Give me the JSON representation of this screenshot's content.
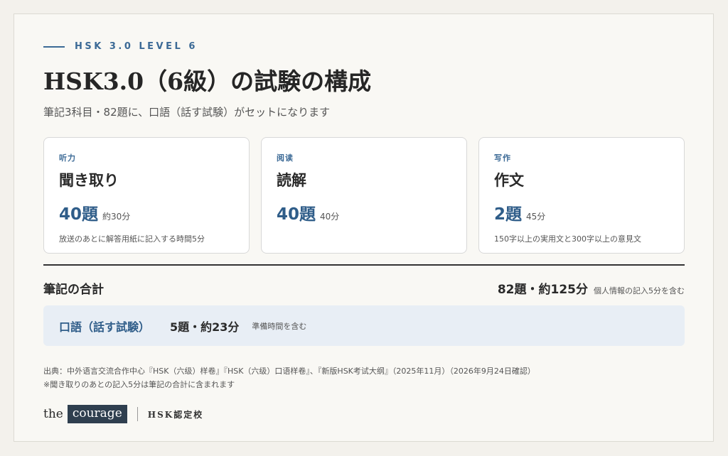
{
  "eyebrow": "HSK 3.0 LEVEL 6",
  "title": "HSK3.0（6級）の試験の構成",
  "subtitle": "筆記3科目・82題に、口語（話す試験）がセットになります",
  "cards": [
    {
      "category": "听力",
      "name": "聞き取り",
      "count": "40題",
      "time": "約30分",
      "note": "放送のあとに解答用紙に記入する時間5分"
    },
    {
      "category": "阅读",
      "name": "読解",
      "count": "40題",
      "time": "40分",
      "note": ""
    },
    {
      "category": "写作",
      "name": "作文",
      "count": "2題",
      "time": "45分",
      "note": "150字以上の実用文と300字以上の意見文"
    }
  ],
  "written_total": {
    "label": "筆記の合計",
    "value": "82題・約125分",
    "note": "個人情報の記入5分を含む"
  },
  "speaking": {
    "name": "口語（話す試験）",
    "value": "5題・約23分",
    "note": "準備時間を含む"
  },
  "source": {
    "line1": "出典：中外语言交流合作中心『HSK（六级）样卷』『HSK（六级）口语样卷』、『新版HSK考试大纲』（2025年11月）（2026年9月24日確認）",
    "line2": "※聞き取りのあとの記入5分は筆記の合計に含まれます"
  },
  "footer": {
    "logo_the": "the",
    "logo_courage": "courage",
    "school": "HSK認定校"
  }
}
